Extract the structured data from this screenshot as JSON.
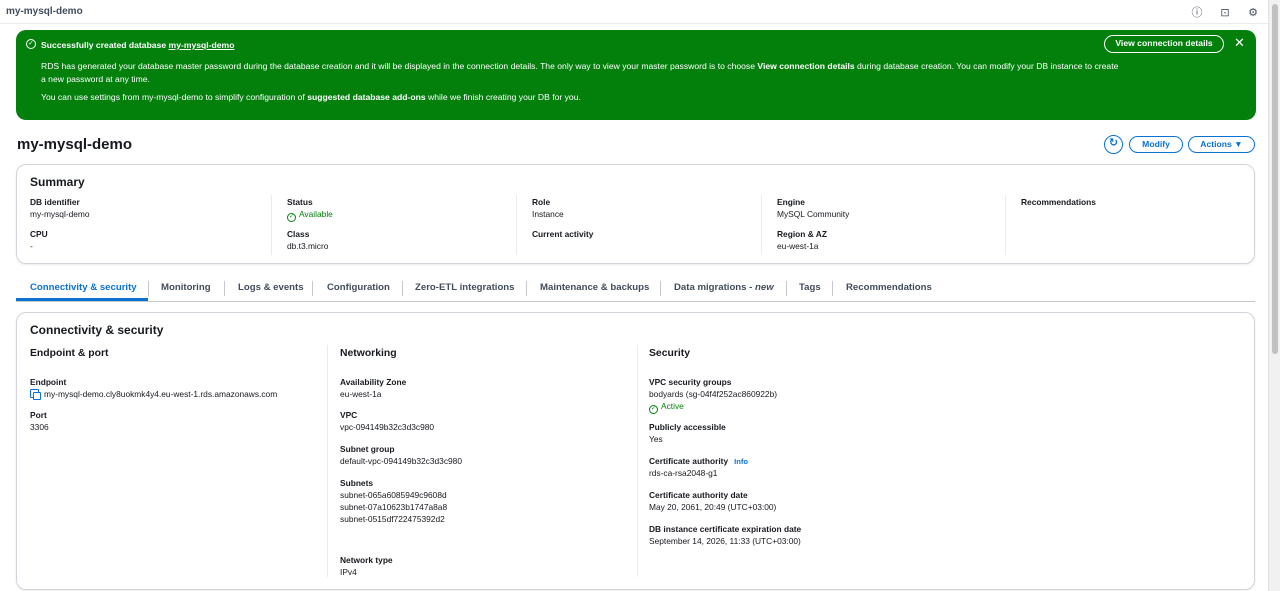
{
  "topbar": {
    "title": "my-mysql-demo",
    "icons": [
      "info-icon",
      "feedback-icon",
      "settings-icon"
    ]
  },
  "flash": {
    "headline_prefix": "Successfully created database ",
    "headline_db": "my-mysql-demo",
    "p1_a": "RDS has generated your database master password during the database creation and it will be displayed in the connection details. The only way to view your master password is to choose ",
    "p1_bold": "View connection details",
    "p1_b": " during database creation. You can modify your DB instance to create a new password at any time.",
    "p2_a": "You can use settings from my-mysql-demo to simplify configuration of ",
    "p2_bold": "suggested database add-ons",
    "p2_b": " while we finish creating your DB for you.",
    "view_button": "View connection details",
    "close": "✕",
    "color": "#037f0c"
  },
  "header": {
    "title": "my-mysql-demo",
    "refresh": "↻",
    "modify": "Modify",
    "actions": "Actions ▼"
  },
  "summary": {
    "title": "Summary",
    "db_identifier_label": "DB identifier",
    "db_identifier": "my-mysql-demo",
    "cpu_label": "CPU",
    "cpu": "-",
    "status_label": "Status",
    "status": "Available",
    "class_label": "Class",
    "class": "db.t3.micro",
    "role_label": "Role",
    "role": "Instance",
    "activity_label": "Current activity",
    "engine_label": "Engine",
    "engine": "MySQL Community",
    "region_label": "Region & AZ",
    "region": "eu-west-1a",
    "recommendations_label": "Recommendations"
  },
  "tabs": [
    "Connectivity & security",
    "Monitoring",
    "Logs & events",
    "Configuration",
    "Zero-ETL integrations",
    "Maintenance & backups",
    "Data migrations - ",
    "Tags",
    "Recommendations"
  ],
  "tab_new_suffix": "new",
  "connectivity": {
    "title": "Connectivity & security",
    "endpoint_port": {
      "heading": "Endpoint & port",
      "endpoint_label": "Endpoint",
      "endpoint": "my-mysql-demo.cly8uokmk4y4.eu-west-1.rds.amazonaws.com",
      "port_label": "Port",
      "port": "3306"
    },
    "networking": {
      "heading": "Networking",
      "az_label": "Availability Zone",
      "az": "eu-west-1a",
      "vpc_label": "VPC",
      "vpc": "vpc-094149b32c3d3c980",
      "subnet_group_label": "Subnet group",
      "subnet_group": "default-vpc-094149b32c3d3c980",
      "subnets_label": "Subnets",
      "subnets": [
        "subnet-065a6085949c9608d",
        "subnet-07a10623b1747a8a8",
        "subnet-0515df722475392d2"
      ],
      "network_type_label": "Network type",
      "network_type": "IPv4"
    },
    "security": {
      "heading": "Security",
      "sg_label": "VPC security groups",
      "sg": "bodyards (sg-04f4f252ac860922b)",
      "sg_status": "Active",
      "public_label": "Publicly accessible",
      "public": "Yes",
      "ca_label": "Certificate authority",
      "ca_info": "Info",
      "ca": "rds-ca-rsa2048-g1",
      "ca_date_label": "Certificate authority date",
      "ca_date": "May 20, 2061, 20:49 (UTC+03:00)",
      "cert_exp_label": "DB instance certificate expiration date",
      "cert_exp": "September 14, 2026, 11:33 (UTC+03:00)"
    }
  }
}
